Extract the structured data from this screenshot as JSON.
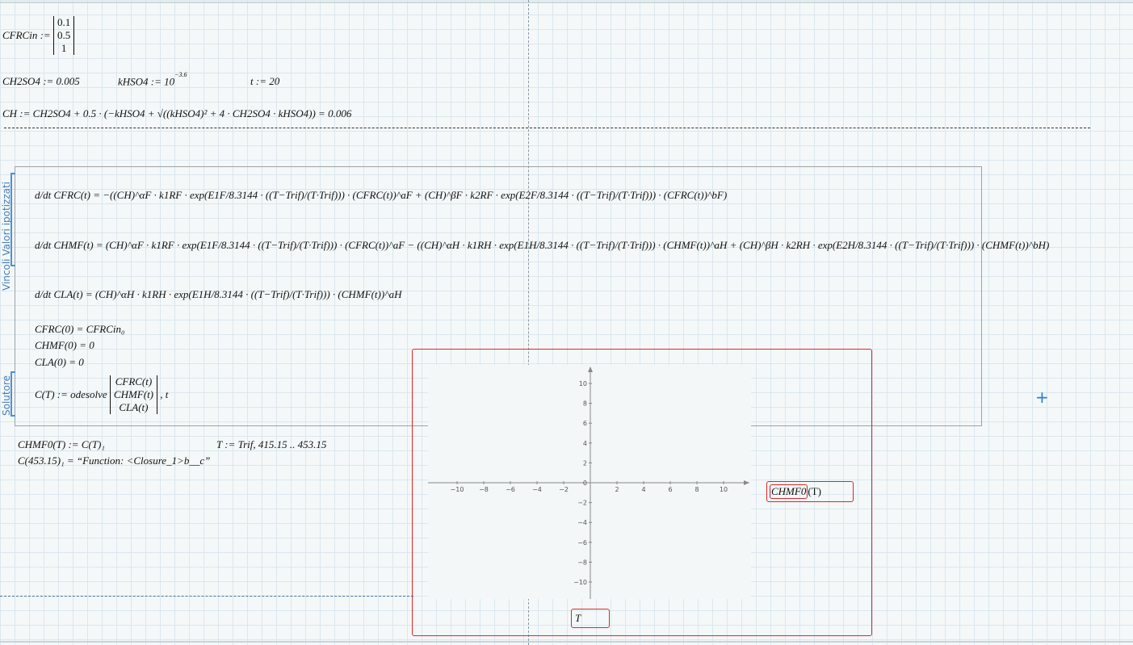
{
  "window": {
    "title": ""
  },
  "definitions": {
    "cfrcin_lhs": "CFRCin :=",
    "cfrcin_values": [
      "0.1",
      "0.5",
      "1"
    ],
    "ch2so4": "CH2SO4 := 0.005",
    "khso4_base": "kHSO4 := 10",
    "khso4_exp": "−3.6",
    "t_def": "t := 20",
    "ch_def": "CH := CH2SO4 + 0.5 · (−kHSO4 + √((kHSO4)² + 4 · CH2SO4 · kHSO4)) = 0.006"
  },
  "solve_block": {
    "label_constraints": "Vincoli Valori ipotizzati",
    "label_solver": "Solutore",
    "eq1": "d/dt CFRC(t) = −((CH)^αF · k1RF · exp(E1F/8.3144 · ((T−Trif)/(T·Trif))) · (CFRC(t))^aF + (CH)^βF · k2RF · exp(E2F/8.3144 · ((T−Trif)/(T·Trif))) · (CFRC(t))^bF)",
    "eq2": "d/dt CHMF(t) = (CH)^αF · k1RF · exp(E1F/8.3144 · ((T−Trif)/(T·Trif))) · (CFRC(t))^aF − ((CH)^αH · k1RH · exp(E1H/8.3144 · ((T−Trif)/(T·Trif))) · (CHMF(t))^aH + (CH)^βH · k2RH · exp(E2H/8.3144 · ((T−Trif)/(T·Trif))) · (CHMF(t))^bH)",
    "eq3": "d/dt CLA(t) = (CH)^αH · k1RH · exp(E1H/8.3144 · ((T−Trif)/(T·Trif))) · (CHMF(t))^aH",
    "ic1": "CFRC(0) = CFRCin₀",
    "ic2": "CHMF(0) = 0",
    "ic3": "CLA(0) = 0",
    "solver_lhs": "C(T) := odesolve",
    "solver_vector": [
      "CFRC(t)",
      "CHMF(t)",
      "CLA(t)"
    ],
    "solver_var": ", t"
  },
  "after": {
    "chmf0_def": "CHMF0(T) := C(T)₁",
    "range_def": "T := Trif, 415.15 .. 453.15",
    "eval": "C(453.15)₁ = “Function: <Closure_1>b__c”"
  },
  "plot": {
    "y_trace_label": "CHMF0",
    "y_trace_arg": "(T)",
    "x_label": "T",
    "x_ticks": [
      "−10",
      "−8",
      "−6",
      "−4",
      "−2",
      "0",
      "2",
      "4",
      "6",
      "8",
      "10"
    ],
    "y_ticks": [
      "10",
      "8",
      "6",
      "4",
      "2",
      "0",
      "−2",
      "−4",
      "−6",
      "−8",
      "−10"
    ],
    "colors": {
      "frame": "#e02626",
      "axes": "#888888"
    }
  },
  "marker": "+"
}
